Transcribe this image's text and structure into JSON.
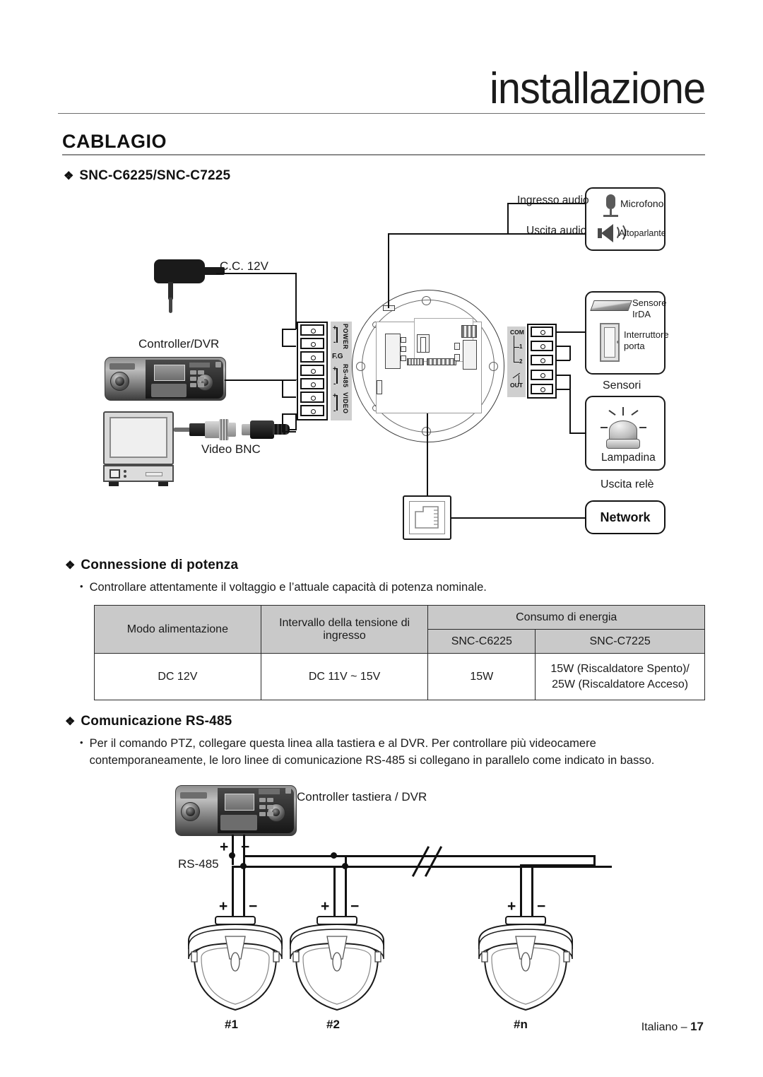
{
  "header": {
    "title": "installazione"
  },
  "section": {
    "title": "CABLAGIO"
  },
  "headings": {
    "models": "SNC-C6225/SNC-C7225",
    "power_connection": "Connessione di potenza",
    "rs485_communication": "Comunicazione RS-485",
    "diamond_bullet": "❖",
    "dot_bullet": "•"
  },
  "diagram_top": {
    "dc_power_label": "C.C. 12V",
    "controller_label": "Controller/DVR",
    "video_bnc_label": "Video BNC",
    "audio_in_label": "Ingresso audio",
    "audio_out_label": "Uscita audio",
    "microphone_label": "Microfono",
    "speaker_label": "Altoparlante",
    "irda_sensor_label_line1": "Sensore",
    "irda_sensor_label_line2": "IrDA",
    "door_switch_label_line1": "Interruttore",
    "door_switch_label_line2": "porta",
    "sensors_label": "Sensori",
    "lamp_label": "Lampadina",
    "relay_output_label": "Uscita relè",
    "network_label": "Network",
    "terminal_block": {
      "power": "POWER",
      "fg": "F.G",
      "rs485": "RS-485",
      "video": "VIDEO",
      "plus": "+",
      "minus": "-"
    },
    "sensor_terminal": {
      "com": "COM",
      "pin1": "1",
      "pin2": "2",
      "out": "OUT"
    }
  },
  "power_section": {
    "note": "Controllare attentamente il voltaggio e l’attuale capacità di potenza nominale.",
    "table": {
      "headers": {
        "mode": "Modo alimentazione",
        "voltage_range_line1": "Intervallo della tensione di",
        "voltage_range_line2": "ingresso",
        "consumption": "Consumo di energia",
        "model_a": "SNC-C6225",
        "model_b": "SNC-C7225"
      },
      "rows": [
        {
          "mode": "DC 12V",
          "voltage_range": "DC 11V ~ 15V",
          "consumption_a": "15W",
          "consumption_b_line1": "15W (Riscaldatore Spento)/",
          "consumption_b_line2": "25W (Riscaldatore Acceso)"
        }
      ]
    }
  },
  "rs485_section": {
    "note_line1": "Per il comando PTZ, collegare questa linea alla tastiera e al DVR. Per controllare più videocamere",
    "note_line2": "contemporaneamente, le loro linee di comunicazione RS-485 si collegano in parallelo come indicato in basso.",
    "diagram": {
      "controller_label": "Controller tastiera / DVR",
      "bus_label": "RS-485",
      "plus": "+",
      "minus": "−",
      "cameras": [
        {
          "id": "#1"
        },
        {
          "id": "#2"
        },
        {
          "id": "#n"
        }
      ]
    }
  },
  "footer": {
    "language": "Italiano – ",
    "page": "17"
  },
  "colors": {
    "table_header_bg": "#c9c9c9",
    "rule": "#6e6e6e",
    "text": "#1a1a1a"
  }
}
